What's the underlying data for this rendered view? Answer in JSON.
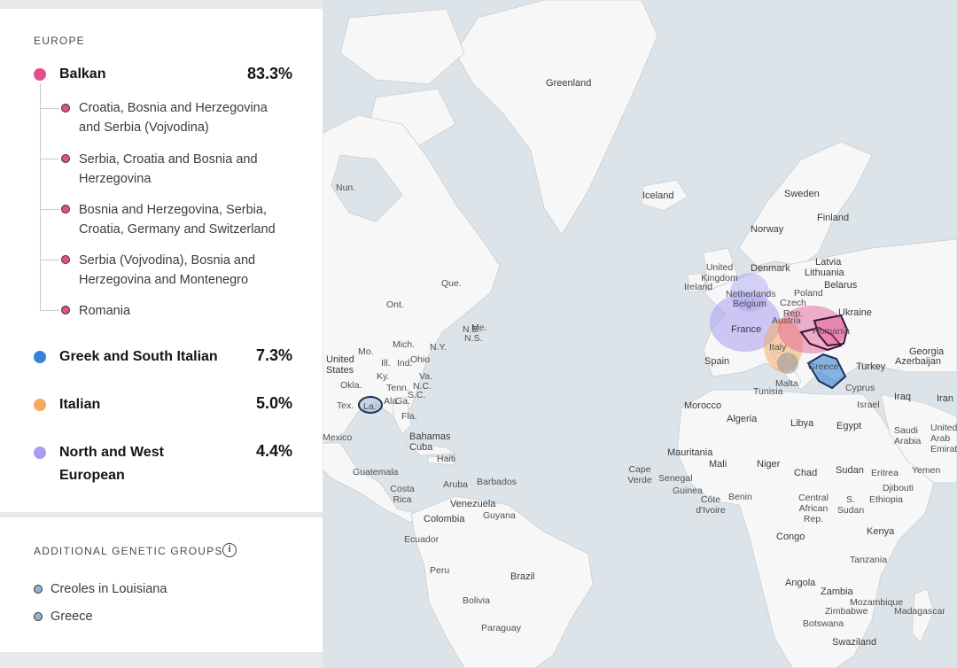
{
  "panel": {
    "section_europe": "EUROPE",
    "groups": [
      {
        "name": "Balkan",
        "percent": "83.3%",
        "color": "#e0508d"
      },
      {
        "name": "Greek and South Italian",
        "percent": "7.3%",
        "color": "#3a82d6"
      },
      {
        "name": "Italian",
        "percent": "5.0%",
        "color": "#f5a85e"
      },
      {
        "name": "North and West European",
        "percent": "4.4%",
        "color": "#a79ef2"
      }
    ],
    "balkan_subgroups": [
      "Croatia, Bosnia and Herzegovina and Serbia (Vojvodina)",
      "Serbia, Croatia and Bosnia and Herzegovina",
      "Bosnia and Herzegovina, Serbia, Croatia, Germany and Switzerland",
      "Serbia (Vojvodina), Bosnia and Herzegovina and Montenegro",
      "Romania"
    ],
    "additional_title": "ADDITIONAL GENETIC GROUPS",
    "info_icon": "info-icon",
    "additional_groups": [
      "Creoles in Louisiana",
      "Greece"
    ]
  },
  "map": {
    "labels": [
      "Greenland",
      "Iceland",
      "Sweden",
      "Finland",
      "Norway",
      "Latvia",
      "Lithuania",
      "Denmark",
      "Belarus",
      "United Kingdom",
      "Ireland",
      "Netherlands",
      "Belgium",
      "Poland",
      "Czech Rep.",
      "Ukraine",
      "France",
      "Austria",
      "Romania",
      "Italy",
      "Spain",
      "Greece",
      "Turkey",
      "Georgia",
      "Azerbaijan",
      "Cyprus",
      "Malta",
      "Tunisia",
      "Morocco",
      "Algeria",
      "Libya",
      "Egypt",
      "Iraq",
      "Iran",
      "Israel",
      "Saudi Arabia",
      "United Arab Emirates",
      "Mauritania",
      "Mali",
      "Niger",
      "Chad",
      "Sudan",
      "Eritrea",
      "Yemen",
      "Djibouti",
      "Ethiopia",
      "Cape Verde",
      "Senegal",
      "Guinea",
      "Côte d'Ivoire",
      "Benin",
      "Central African Rep.",
      "S. Sudan",
      "Kenya",
      "Congo",
      "Tanzania",
      "Angola",
      "Zambia",
      "Mozambique",
      "Zimbabwe",
      "Madagascar",
      "Botswana",
      "Swaziland",
      "United States",
      "Mexico",
      "Bahamas",
      "Cuba",
      "Haiti",
      "Guatemala",
      "Costa Rica",
      "Aruba",
      "Barbados",
      "Venezuela",
      "Guyana",
      "Colombia",
      "Ecuador",
      "Peru",
      "Brazil",
      "Bolivia",
      "Paraguay",
      "Que.",
      "Ont.",
      "N.B.",
      "N.S.",
      "Me.",
      "Mich.",
      "N.Y.",
      "Ill.",
      "Ind.",
      "Ohio",
      "Va.",
      "N.C.",
      "S.C.",
      "Ga.",
      "Ala.",
      "Fla.",
      "La.",
      "Tex.",
      "Okla.",
      "Mo.",
      "Ky.",
      "Tenn.",
      "Nun."
    ]
  }
}
